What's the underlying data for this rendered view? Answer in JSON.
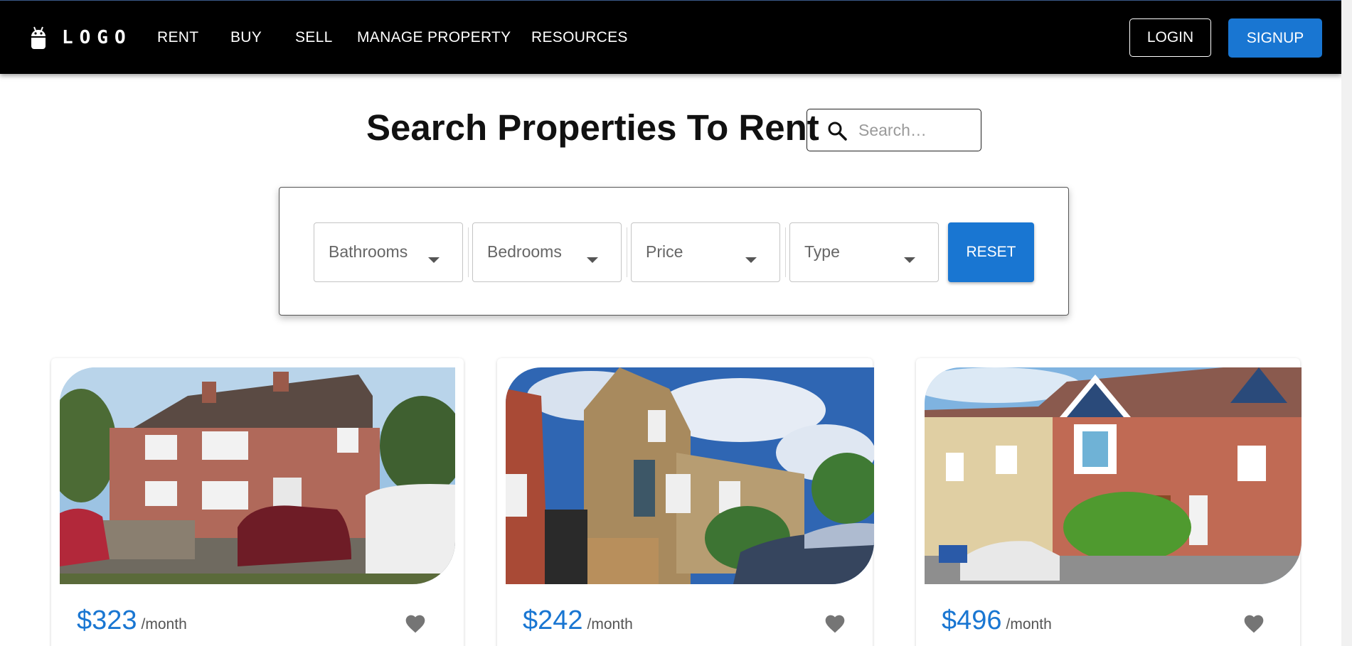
{
  "nav": {
    "logo_text": "LOGO",
    "links": [
      "RENT",
      "BUY",
      "SELL",
      "MANAGE PROPERTY",
      "RESOURCES"
    ],
    "login_label": "LOGIN",
    "signup_label": "SIGNUP"
  },
  "header": {
    "title": "Search Properties To Rent",
    "search_placeholder": "Search…",
    "search_icon": "search-icon"
  },
  "filters": {
    "selects": [
      "Bathrooms",
      "Bedrooms",
      "Price",
      "Type"
    ],
    "reset_label": "RESET"
  },
  "listings": [
    {
      "price": "$323",
      "period": "/month",
      "favorite_icon": "heart-icon"
    },
    {
      "price": "$242",
      "period": "/month",
      "favorite_icon": "heart-icon"
    },
    {
      "price": "$496",
      "period": "/month",
      "favorite_icon": "heart-icon"
    }
  ],
  "colors": {
    "navbar_bg": "#000000",
    "accent": "#1976d2",
    "heart": "#757575"
  }
}
